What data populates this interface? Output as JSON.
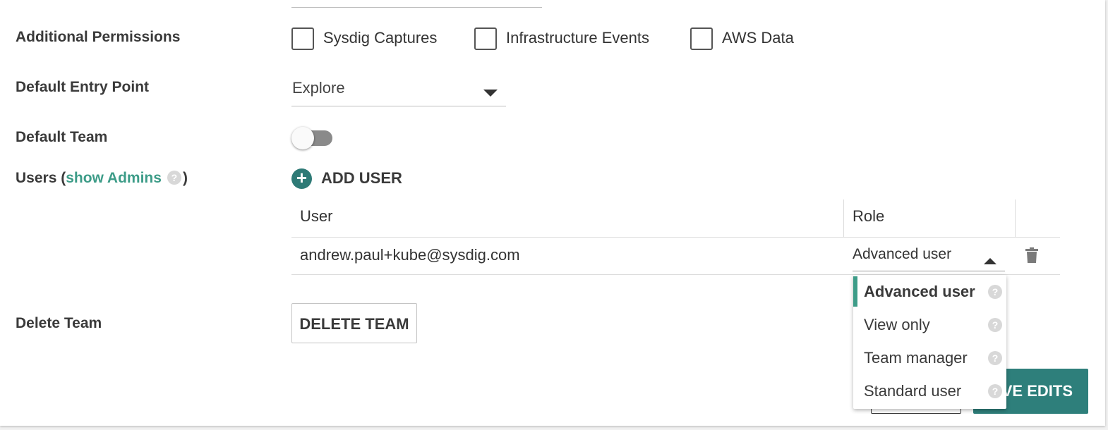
{
  "form": {
    "additional_permissions_label": "Additional Permissions",
    "default_entry_point_label": "Default Entry Point",
    "default_team_label": "Default Team",
    "delete_team_label": "Delete Team",
    "users_label_prefix": "Users (",
    "users_label_link": "show Admins",
    "users_label_suffix": ")"
  },
  "permissions": [
    {
      "label": "Sysdig Captures",
      "checked": false
    },
    {
      "label": "Infrastructure Events",
      "checked": false
    },
    {
      "label": "AWS Data",
      "checked": false
    }
  ],
  "entry_point": {
    "value": "Explore"
  },
  "default_team": {
    "enabled": false
  },
  "add_user": {
    "label": "ADD USER"
  },
  "table": {
    "headers": [
      "User",
      "Role"
    ],
    "rows": [
      {
        "user": "andrew.paul+kube@sysdig.com",
        "role": "Advanced user"
      }
    ]
  },
  "role_dropdown": {
    "selected": "Advanced user",
    "options": [
      "Advanced user",
      "View only",
      "Team manager",
      "Standard user"
    ]
  },
  "buttons": {
    "delete_team": "DELETE TEAM",
    "save_edits": "SAVE EDITS"
  },
  "help_glyph": "?",
  "add_glyph": "+",
  "colors": {
    "accent": "#3d9c88",
    "primary_button": "#2e7f7b",
    "add_icon": "#2e7a76"
  }
}
